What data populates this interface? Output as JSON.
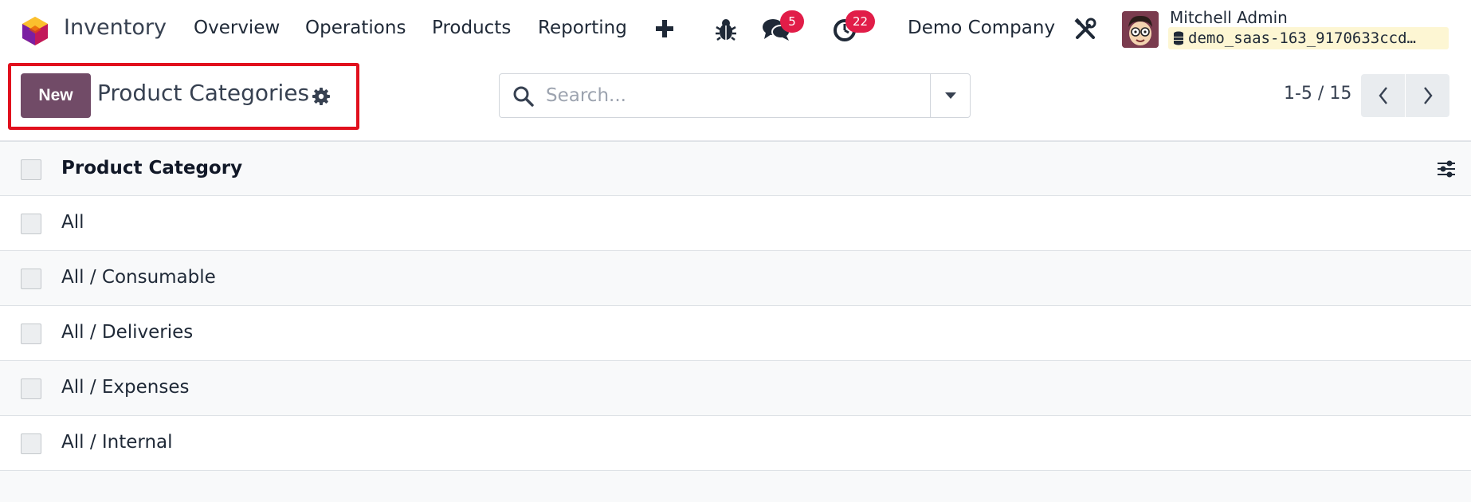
{
  "navbar": {
    "app_name": "Inventory",
    "menus": [
      "Overview",
      "Operations",
      "Products",
      "Reporting"
    ],
    "add_icon": "plus-icon",
    "chat_badge": "5",
    "activity_badge": "22",
    "company": "Demo Company",
    "user_name": "Mitchell Admin",
    "database": "demo_saas-163_9170633ccd…"
  },
  "control_panel": {
    "new_label": "New",
    "title": "Product Categories",
    "search_placeholder": "Search...",
    "pager": "1-5 / 15"
  },
  "list": {
    "column_header": "Product Category",
    "rows": [
      "All",
      "All / Consumable",
      "All / Deliveries",
      "All / Expenses",
      "All / Internal"
    ]
  },
  "colors": {
    "brand": "#714b67",
    "badge": "#e11d48",
    "highlight": "#e1101d",
    "db_background": "#fdf6d3"
  }
}
